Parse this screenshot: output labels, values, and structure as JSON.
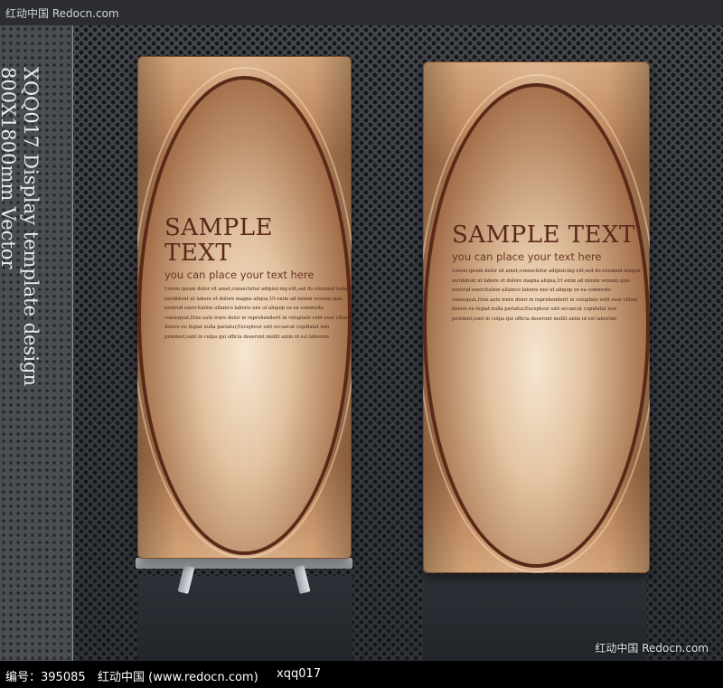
{
  "top_watermark": "红动中国 Redocn.com",
  "side_text": {
    "line1": "XQQ017 Display template design",
    "line2": "800X1800mm Vector"
  },
  "banners": [
    {
      "title": "SAMPLE TEXT",
      "subtitle": "you can place your text here",
      "body": [
        "Lorem ipsum dolor sit amet,consectetur adipisicing elit,sed do eiusmod tempor",
        "incididunt ut labore et dolore magna aliqua,Ut enim ad minim veniam,quis",
        "nostrud exercitation ullamco laboris nisi ut aliquip ex ea commodo",
        "consequat,Duis aute irure dolor in reprehenderit in voluptate velit esse cillum",
        "dolore eu fugiat nulla pariatur,Excepteur sint occaecat cupidatat non",
        "proident,sunt in culpa qui officia deserunt mollit anim id est laborum"
      ]
    },
    {
      "title": "SAMPLE TEXT",
      "subtitle": "you can place your text here",
      "body": [
        "Lorem ipsum dolor sit amet,consectetur adipisicing elit,sed do eiusmod tempor",
        "incididunt ut labore et dolore magna aliqua,Ut enim ad minim veniam,quis",
        "nostrud exercitation ullamco laboris nisi ut aliquip ex ea commodo",
        "consequat,Duis aute irure dolor in reprehenderit in voluptate velit esse cillum",
        "dolore eu fugiat nulla pariatur,Excepteur sint occaecat cupidatat non",
        "proident,sunt in culpa qui officia deserunt mollit anim id est laborum"
      ]
    }
  ],
  "corner_watermark": "红动中国 Redocn.com",
  "bottom_bar": {
    "id_text": "编号：395085",
    "site_text": "红动中国 (www.redocn.com)",
    "code_text": "xqq017"
  },
  "colors": {
    "banner_gold": "#c99467",
    "title_brown": "#5a2718",
    "background_dark": "#3a3d42"
  }
}
